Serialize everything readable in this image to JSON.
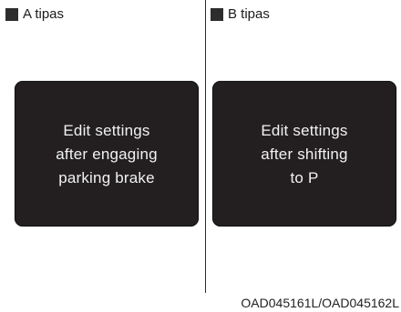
{
  "panels": [
    {
      "label": "A tipas",
      "message": "Edit settings\nafter engaging\nparking brake"
    },
    {
      "label": "B tipas",
      "message": "Edit settings\nafter shifting\nto P"
    }
  ],
  "caption": "OAD045161L/OAD045162L",
  "colors": {
    "screen_background": "#231f20",
    "screen_text": "#f2f2f2",
    "label_marker": "#2d2d2d"
  }
}
